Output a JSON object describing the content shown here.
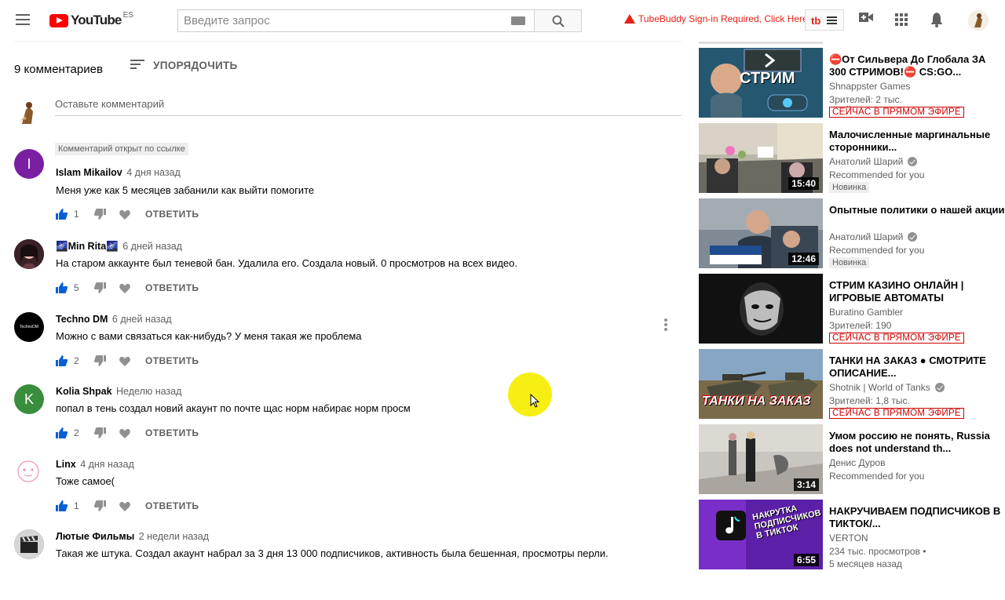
{
  "header": {
    "logo_text": "YouTube",
    "logo_region": "ES",
    "search_placeholder": "Введите запрос",
    "tubebuddy_warning": "TubeBuddy Sign-in Required, Click Here",
    "tubebuddy_logo": "tb"
  },
  "comments": {
    "count_label": "9 комментариев",
    "sort_label": "УПОРЯДОЧИТЬ",
    "add_placeholder": "Оставьте комментарий",
    "reply_label": "ОТВЕТИТЬ",
    "items": [
      {
        "badge": "Комментарий открыт по ссылке",
        "author": "Islam Mikailov",
        "time": "4 дня назад",
        "text": "Меня уже как  5 месяцев забанили как выйти помогите",
        "likes": "1",
        "avatar_letter": "I",
        "avatar_color": "#7b1fa2"
      },
      {
        "author": "🌌Min Rita🌌",
        "time": "6 дней назад",
        "text": "На старом аккаунте был теневой бан. Удалила его. Создала новый. 0 просмотров на всех видео.",
        "likes": "5"
      },
      {
        "author": "Techno DM",
        "time": "6 дней назад",
        "text": "Можно с вами связаться как-нибудь? У меня такая же проблема",
        "likes": "2",
        "avatar_text": "TechnoDM"
      },
      {
        "author": "Kolia Shpak",
        "time": "Неделю назад",
        "text": "попал в тень создал новий акаунт по почте щас норм набирає норм просм",
        "likes": "2",
        "avatar_letter": "K",
        "avatar_color": "#388e3c"
      },
      {
        "author": "Linx",
        "time": "4 дня назад",
        "text": "Тоже самое(",
        "likes": "1"
      },
      {
        "author": "Лютые Фильмы",
        "time": "2 недели назад",
        "text": "Такая же штука. Создал акаунт набрал за 3 дня 13 000  подписчиков, активность была бешенная, просмотры перли."
      }
    ]
  },
  "sidebar": {
    "videos": [
      {
        "title": "⛔От Сильвера До Глобала ЗА 300 СТРИМОВ!⛔ CS:GO...",
        "channel": "Shnappster Games",
        "sub": "Зрителей: 2 тыс.",
        "live": "СЕЙЧАС В ПРЯМОМ ЭФИРЕ",
        "thumb_text": "СТРИМ"
      },
      {
        "title": "Малочисленные маргинальные сторонники...",
        "channel": "Анатолий Шарий",
        "sub": "Recommended for you",
        "new": "Новинка",
        "duration": "15:40"
      },
      {
        "title": "Опытные политики о нашей акции",
        "channel": "Анатолий Шарий",
        "sub": "Recommended for you",
        "new": "Новинка",
        "duration": "12:46"
      },
      {
        "title": "СТРИМ КАЗИНО ОНЛАЙН | ИГРОВЫЕ АВТОМАТЫ",
        "channel": "Buratino Gambler",
        "sub": "Зрителей: 190",
        "live": "СЕЙЧАС В ПРЯМОМ ЭФИРЕ"
      },
      {
        "title": "ТАНКИ НА ЗАКАЗ ● СМОТРИТЕ ОПИСАНИЕ...",
        "channel": "Shotnik | World of Tanks",
        "sub": "Зрителей: 1,8 тыс.",
        "live": "СЕЙЧАС В ПРЯМОМ ЭФИРЕ",
        "thumb_text": "ТАНКИ НА ЗАКАЗ"
      },
      {
        "title": "Умом россию не понять, Russia does not understand th...",
        "channel": "Денис Дуров",
        "sub": "Recommended for you",
        "duration": "3:14"
      },
      {
        "title": "НАКРУЧИВАЕМ ПОДПИСЧИКОВ В ТИКТОК/...",
        "channel": "VERTON",
        "sub": "234 тыс. просмотров •",
        "sub2": "5 месяцев назад",
        "duration": "6:55",
        "thumb_text": "НАКРУТКА ПОДПИСЧИКОВ В ТИКТОК"
      }
    ]
  }
}
